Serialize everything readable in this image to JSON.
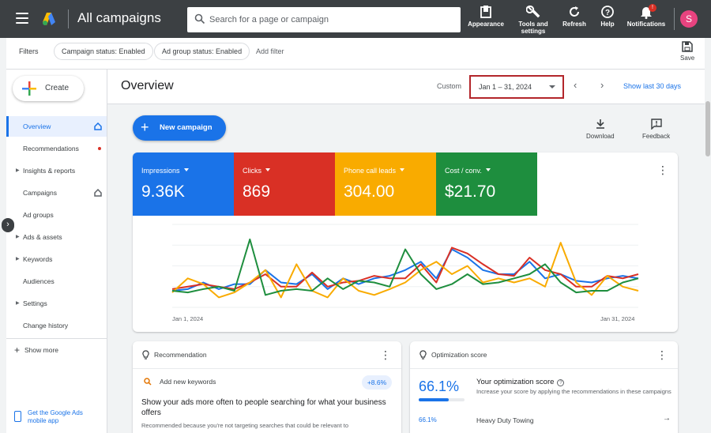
{
  "topbar": {
    "title": "All campaigns",
    "search_placeholder": "Search for a page or campaign",
    "buttons": {
      "appearance": "Appearance",
      "tools_line1": "Tools and",
      "tools_line2": "settings",
      "refresh": "Refresh",
      "help": "Help",
      "notifications": "Notifications"
    },
    "notification_count": "!",
    "avatar_letter": "S"
  },
  "filterbar": {
    "label": "Filters",
    "chips": [
      "Campaign status: Enabled",
      "Ad group status: Enabled"
    ],
    "add_filter": "Add filter",
    "save": "Save"
  },
  "sidebar": {
    "create": "Create",
    "items": [
      {
        "label": "Overview",
        "active": true
      },
      {
        "label": "Recommendations"
      },
      {
        "label": "Insights & reports"
      },
      {
        "label": "Campaigns"
      },
      {
        "label": "Ad groups"
      },
      {
        "label": "Ads & assets"
      },
      {
        "label": "Keywords"
      },
      {
        "label": "Audiences"
      },
      {
        "label": "Settings"
      },
      {
        "label": "Change history"
      }
    ],
    "show_more": "Show more",
    "mobile_app": "Get the Google Ads mobile app"
  },
  "main": {
    "title": "Overview",
    "custom_label": "Custom",
    "date_range": "Jan 1 – 31, 2024",
    "show_last": "Show last 30 days",
    "new_campaign": "New campaign",
    "download": "Download",
    "feedback": "Feedback"
  },
  "metrics": [
    {
      "name": "Impressions",
      "value": "9.36K",
      "color": "#1a73e8"
    },
    {
      "name": "Clicks",
      "value": "869",
      "color": "#d93025"
    },
    {
      "name": "Phone call leads",
      "value": "304.00",
      "color": "#f9ab00"
    },
    {
      "name": "Cost / conv.",
      "value": "$21.70",
      "color": "#1e8e3e"
    }
  ],
  "chart_data": {
    "type": "line",
    "x_start_label": "Jan 1, 2024",
    "x_end_label": "Jan 31, 2024",
    "ylim": [
      0,
      100
    ],
    "series": [
      {
        "color": "#1a73e8",
        "values": [
          20,
          22,
          30,
          22,
          28,
          28,
          45,
          30,
          28,
          40,
          22,
          35,
          28,
          35,
          38,
          45,
          55,
          35,
          70,
          60,
          45,
          40,
          40,
          55,
          35,
          40,
          32,
          30,
          35,
          38,
          35
        ]
      },
      {
        "color": "#d93025",
        "values": [
          22,
          25,
          28,
          25,
          22,
          30,
          40,
          25,
          25,
          42,
          25,
          30,
          32,
          38,
          35,
          35,
          52,
          30,
          72,
          65,
          52,
          40,
          38,
          60,
          45,
          40,
          25,
          25,
          38,
          35,
          40
        ]
      },
      {
        "color": "#f9ab00",
        "values": [
          18,
          35,
          28,
          12,
          18,
          30,
          45,
          12,
          52,
          20,
          12,
          35,
          20,
          15,
          22,
          30,
          45,
          55,
          40,
          50,
          30,
          35,
          30,
          35,
          25,
          78,
          30,
          15,
          38,
          25,
          20
        ]
      },
      {
        "color": "#1e8e3e",
        "values": [
          20,
          18,
          22,
          25,
          20,
          82,
          15,
          20,
          22,
          20,
          35,
          22,
          32,
          30,
          25,
          70,
          40,
          22,
          28,
          40,
          28,
          30,
          35,
          40,
          52,
          30,
          18,
          20,
          20,
          30,
          35
        ]
      }
    ]
  },
  "recommendation": {
    "header": "Recommendation",
    "item": "Add new keywords",
    "uplift": "+8.6%",
    "title": "Show your ads more often to people searching for what your business offers",
    "subtitle": "Recommended because you're not targeting searches that could be relevant to"
  },
  "optimization": {
    "header": "Optimization score",
    "score": "66.1%",
    "score_fraction": 0.661,
    "title": "Your optimization score",
    "desc": "Increase your score by applying the recommendations in these campaigns",
    "row_score": "66.1%",
    "row_name": "Heavy Duty Towing"
  }
}
